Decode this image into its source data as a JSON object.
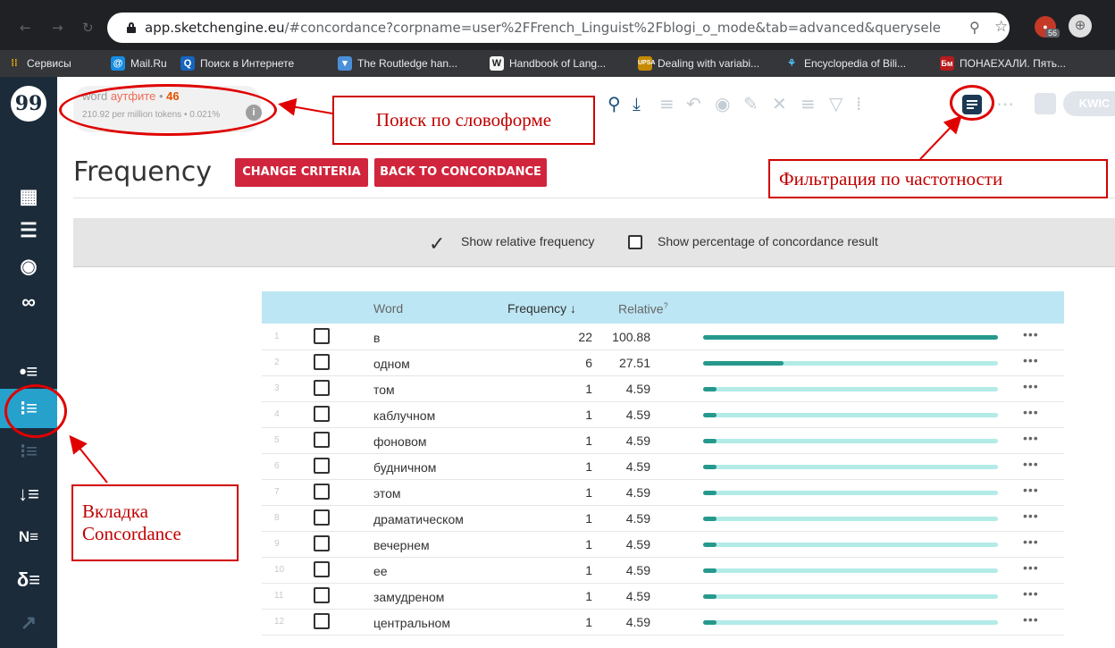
{
  "browser": {
    "url_host": "app.sketchengine.eu",
    "url_rest": "/#concordance?corpname=user%2FFrench_Linguist%2Fblogi_o_mode&tab=advanced&queryselector=word&ke...",
    "extension_badge": "56",
    "bookmarks": [
      {
        "label": "Сервисы",
        "icon": "apps-icon",
        "color": "#fbbc04"
      },
      {
        "label": "Mail.Ru",
        "icon": "mail-ru-icon",
        "color": "#168de2"
      },
      {
        "label": "Поиск в Интернете",
        "icon": "search-icon",
        "color": "#1565c0"
      },
      {
        "label": "The Routledge han...",
        "icon": "routledge-icon",
        "color": "#4a90d9"
      },
      {
        "label": "Handbook of Lang...",
        "icon": "wikipedia-icon",
        "color": "#222222"
      },
      {
        "label": "Dealing with variabi...",
        "icon": "upsa-icon",
        "color": "#c68a00"
      },
      {
        "label": "Encyclopedia of Bili...",
        "icon": "encyclopedia-icon",
        "color": "#1e88e5"
      },
      {
        "label": "ПОНАЕХАЛИ. Пять...",
        "icon": "bm-icon",
        "color": "#b71c1c"
      }
    ]
  },
  "query": {
    "attr": "word",
    "value": "аутфите",
    "count": "46",
    "stats": "210.92 per million tokens • 0.021%"
  },
  "page": {
    "title": "Frequency",
    "change_criteria": "CHANGE CRITERIA",
    "back_to_concordance": "BACK TO CONCORDANCE",
    "kwic": "KWIC"
  },
  "options": {
    "relative_frequency": "Show relative frequency",
    "percentage": "Show percentage of concordance result"
  },
  "table": {
    "headers": {
      "word": "Word",
      "frequency": "Frequency ↓",
      "relative": "Relative",
      "relative_sup": "?"
    },
    "rows": [
      {
        "n": "1",
        "word": "в",
        "freq": "22",
        "rel": "100.88",
        "fill": 1.0
      },
      {
        "n": "2",
        "word": "одном",
        "freq": "6",
        "rel": "27.51",
        "fill": 0.273
      },
      {
        "n": "3",
        "word": "том",
        "freq": "1",
        "rel": "4.59",
        "fill": 0.045
      },
      {
        "n": "4",
        "word": "каблучном",
        "freq": "1",
        "rel": "4.59",
        "fill": 0.045
      },
      {
        "n": "5",
        "word": "фоновом",
        "freq": "1",
        "rel": "4.59",
        "fill": 0.045
      },
      {
        "n": "6",
        "word": "будничном",
        "freq": "1",
        "rel": "4.59",
        "fill": 0.045
      },
      {
        "n": "7",
        "word": "этом",
        "freq": "1",
        "rel": "4.59",
        "fill": 0.045
      },
      {
        "n": "8",
        "word": "драматическом",
        "freq": "1",
        "rel": "4.59",
        "fill": 0.045
      },
      {
        "n": "9",
        "word": "вечернем",
        "freq": "1",
        "rel": "4.59",
        "fill": 0.045
      },
      {
        "n": "10",
        "word": "ее",
        "freq": "1",
        "rel": "4.59",
        "fill": 0.045
      },
      {
        "n": "11",
        "word": "замудреном",
        "freq": "1",
        "rel": "4.59",
        "fill": 0.045
      },
      {
        "n": "12",
        "word": "центральном",
        "freq": "1",
        "rel": "4.59",
        "fill": 0.045
      }
    ]
  },
  "annotations": {
    "search_by_wordform": "Поиск по словоформе",
    "frequency_filter": "Фильтрация по частотности",
    "concordance_tab_line1": "Вкладка",
    "concordance_tab_line2": "Concordance"
  }
}
